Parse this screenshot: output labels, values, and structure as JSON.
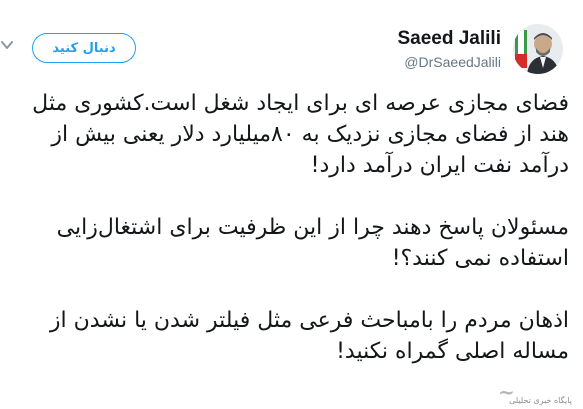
{
  "tweet": {
    "display_name": "Saeed Jalili",
    "handle": "@DrSaeedJalili",
    "follow_label": "دنبال کنید",
    "paragraphs": [
      "فضای مجازی عرصه ای برای ایجاد شغل است.کشوری مثل هند از فضای مجازی نزدیک به ۸۰میلیارد دلار یعنی بیش از درآمد نفت ایران درآمد دارد!",
      "مسئولان پاسخ دهند چرا از این ظرفیت برای اشتغال‌زایی استفاده نمی کنند؟!",
      "اذهان مردم را بامباحث فرعی مثل فیلتر شدن یا نشدن از مساله اصلی گمراه نکنید!"
    ]
  },
  "watermark": {
    "site_text": "پایگاه خبری تحلیلی"
  },
  "colors": {
    "accent": "#1da1f2",
    "text": "#14171a",
    "muted": "#657786"
  },
  "icons": {
    "chevron": "chevron-down-icon",
    "avatar": "avatar"
  }
}
